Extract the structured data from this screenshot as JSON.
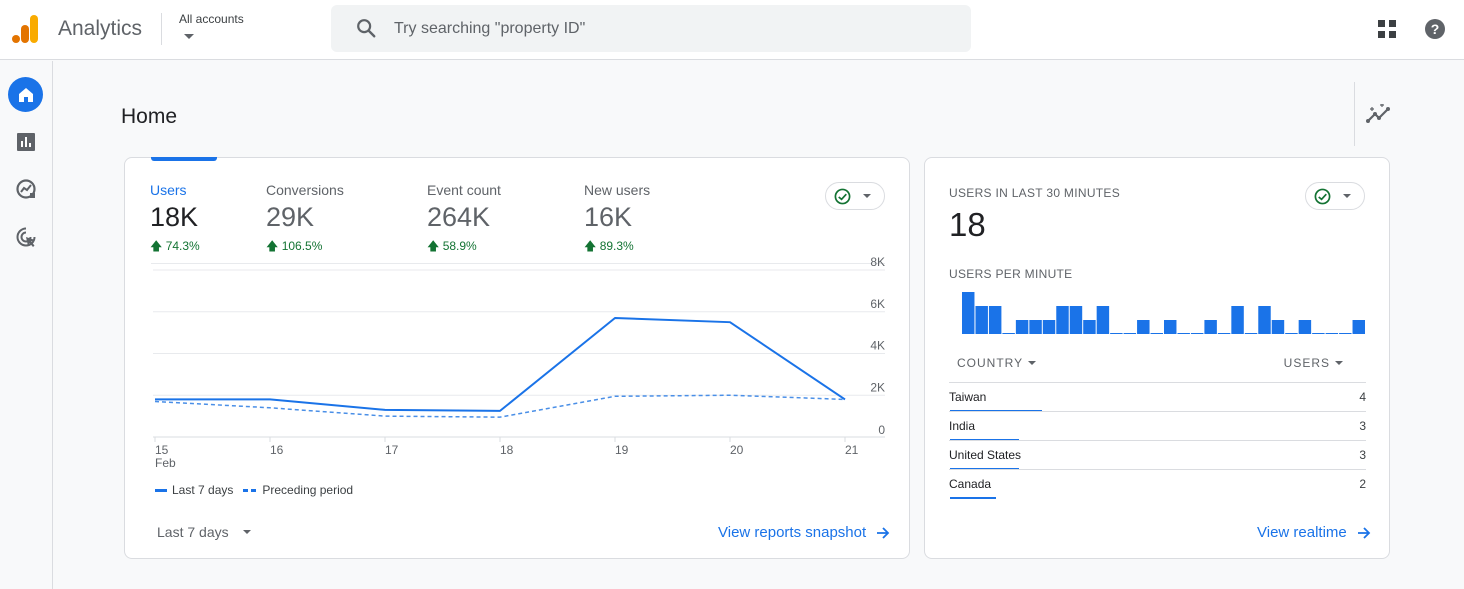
{
  "header": {
    "app_title": "Analytics",
    "account_selector": "All accounts",
    "search_placeholder": "Try searching \"property ID\"",
    "icons": [
      "analytics-logo",
      "search-icon",
      "apps-icon",
      "help-icon"
    ]
  },
  "sidenav": {
    "items": [
      {
        "name": "home",
        "icon": "home-icon",
        "active": true
      },
      {
        "name": "reports",
        "icon": "bar-chart-icon",
        "active": false
      },
      {
        "name": "explore",
        "icon": "explore-icon",
        "active": false
      },
      {
        "name": "advertising",
        "icon": "target-cursor-icon",
        "active": false
      }
    ]
  },
  "page": {
    "title": "Home",
    "insights_icon": "insights-icon"
  },
  "overview_card": {
    "metrics": [
      {
        "label": "Users",
        "value": "18K",
        "delta": "74.3%",
        "active": true
      },
      {
        "label": "Conversions",
        "value": "29K",
        "delta": "106.5%",
        "active": false
      },
      {
        "label": "Event count",
        "value": "264K",
        "delta": "58.9%",
        "active": false
      },
      {
        "label": "New users",
        "value": "16K",
        "delta": "89.3%",
        "active": false
      }
    ],
    "legend": {
      "current": "Last 7 days",
      "previous": "Preceding period"
    },
    "date_range": "Last 7 days",
    "link": "View reports snapshot"
  },
  "chart_data": {
    "type": "line",
    "title": "Users",
    "x": [
      "15",
      "16",
      "17",
      "18",
      "19",
      "20",
      "21"
    ],
    "x_sublabel": "Feb",
    "series": [
      {
        "name": "Last 7 days",
        "style": "solid",
        "values": [
          1800,
          1800,
          1300,
          1250,
          5700,
          5500,
          1800
        ]
      },
      {
        "name": "Preceding period",
        "style": "dashed",
        "values": [
          1700,
          1400,
          1000,
          950,
          1950,
          2000,
          1800
        ]
      }
    ],
    "yticks": [
      "0",
      "2K",
      "4K",
      "6K",
      "8K"
    ],
    "ylim": [
      0,
      8000
    ],
    "grid": true,
    "y_axis_side": "right",
    "legend_position": "bottom-left",
    "colors": {
      "line": "#1a73e8",
      "dashed": "#4a8fe7"
    }
  },
  "realtime_card": {
    "title": "USERS IN LAST 30 MINUTES",
    "value": "18",
    "per_minute_label": "USERS PER MINUTE",
    "per_minute": [
      3,
      2,
      2,
      0,
      1,
      1,
      1,
      2,
      2,
      1,
      2,
      0,
      0,
      1,
      0,
      1,
      0,
      0,
      1,
      0,
      2,
      0,
      2,
      1,
      0,
      1,
      0,
      0,
      0,
      1
    ],
    "table": {
      "headers": {
        "country": "COUNTRY",
        "users": "USERS"
      },
      "rows": [
        {
          "country": "Taiwan",
          "users": "4",
          "share": 1.0
        },
        {
          "country": "India",
          "users": "3",
          "share": 0.75
        },
        {
          "country": "United States",
          "users": "3",
          "share": 0.75
        },
        {
          "country": "Canada",
          "users": "2",
          "share": 0.5
        }
      ]
    },
    "link": "View realtime"
  },
  "colors": {
    "accent": "#1a73e8",
    "positive": "#137333",
    "logo_orange": "#e37400",
    "logo_yellow": "#f9ab00"
  }
}
